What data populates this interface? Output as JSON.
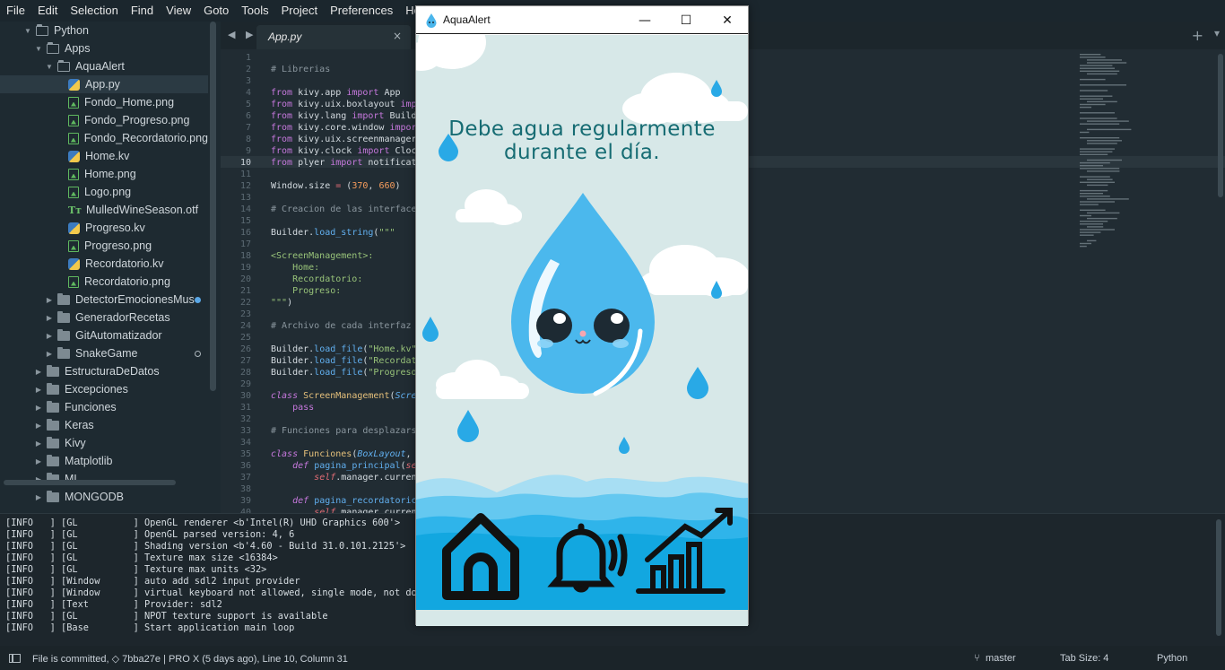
{
  "menu": [
    "File",
    "Edit",
    "Selection",
    "Find",
    "View",
    "Goto",
    "Tools",
    "Project",
    "Preferences",
    "Help"
  ],
  "sidebar": {
    "items": [
      {
        "label": "Python",
        "type": "folder-open",
        "depth": 2
      },
      {
        "label": "Apps",
        "type": "folder-open",
        "depth": 3
      },
      {
        "label": "AquaAlert",
        "type": "folder-open",
        "depth": 4
      },
      {
        "label": "App.py",
        "type": "py",
        "depth": 5,
        "selected": true
      },
      {
        "label": "Fondo_Home.png",
        "type": "img",
        "depth": 5
      },
      {
        "label": "Fondo_Progreso.png",
        "type": "img",
        "depth": 5
      },
      {
        "label": "Fondo_Recordatorio.png",
        "type": "img",
        "depth": 5
      },
      {
        "label": "Home.kv",
        "type": "py",
        "depth": 5
      },
      {
        "label": "Home.png",
        "type": "img",
        "depth": 5
      },
      {
        "label": "Logo.png",
        "type": "img",
        "depth": 5
      },
      {
        "label": "MulledWineSeason.otf",
        "type": "font",
        "depth": 5
      },
      {
        "label": "Progreso.kv",
        "type": "py",
        "depth": 5
      },
      {
        "label": "Progreso.png",
        "type": "img",
        "depth": 5
      },
      {
        "label": "Recordatorio.kv",
        "type": "py",
        "depth": 5
      },
      {
        "label": "Recordatorio.png",
        "type": "img",
        "depth": 5
      },
      {
        "label": "DetectorEmocionesMus",
        "type": "folder",
        "depth": 4,
        "badge": "modified"
      },
      {
        "label": "GeneradorRecetas",
        "type": "folder",
        "depth": 4
      },
      {
        "label": "GitAutomatizador",
        "type": "folder",
        "depth": 4
      },
      {
        "label": "SnakeGame",
        "type": "folder",
        "depth": 4,
        "badge": "untracked"
      },
      {
        "label": "EstructuraDeDatos",
        "type": "folder",
        "depth": 3
      },
      {
        "label": "Excepciones",
        "type": "folder",
        "depth": 3
      },
      {
        "label": "Funciones",
        "type": "folder",
        "depth": 3
      },
      {
        "label": "Keras",
        "type": "folder",
        "depth": 3
      },
      {
        "label": "Kivy",
        "type": "folder",
        "depth": 3
      },
      {
        "label": "Matplotlib",
        "type": "folder",
        "depth": 3
      },
      {
        "label": "ML",
        "type": "folder",
        "depth": 3
      },
      {
        "label": "MONGODB",
        "type": "folder",
        "depth": 3
      }
    ]
  },
  "editor": {
    "tab_label": "App.py",
    "tab_close": "×",
    "nav_arrows": "◀ ▶",
    "new_tab": "+",
    "current_line": 10,
    "line_count": 41
  },
  "app_window": {
    "title": "AquaAlert",
    "minimize": "—",
    "maximize": "☐",
    "close": "✕",
    "message_line1": "Debe agua regularmente",
    "message_line2": "durante el día.",
    "nav": [
      "home-button",
      "reminder-button",
      "progress-button"
    ]
  },
  "console": [
    "[INFO   ] [GL          ] OpenGL renderer <b'Intel(R) UHD Graphics 600'>",
    "[INFO   ] [GL          ] OpenGL parsed version: 4, 6",
    "[INFO   ] [GL          ] Shading version <b'4.60 - Build 31.0.101.2125'>",
    "[INFO   ] [GL          ] Texture max size <16384>",
    "[INFO   ] [GL          ] Texture max units <32>",
    "[INFO   ] [Window      ] auto add sdl2 input provider",
    "[INFO   ] [Window      ] virtual keyboard not allowed, single mode, not docked",
    "[INFO   ] [Text        ] Provider: sdl2",
    "[INFO   ] [GL          ] NPOT texture support is available",
    "[INFO   ] [Base        ] Start application main loop"
  ],
  "status": {
    "commit": "File is committed, ◇ 7bba27e | PRO X (5 days ago), Line 10, Column 31",
    "branch": "master",
    "tab_size": "Tab Size: 4",
    "syntax": "Python"
  },
  "colors": {
    "sky": "#d7e8e8",
    "drop": "#4bb6ec",
    "cloud": "#ffffff",
    "wave_dark": "#0fa7e0",
    "message": "#166c73",
    "modified_dot": "#5aa7e6"
  }
}
